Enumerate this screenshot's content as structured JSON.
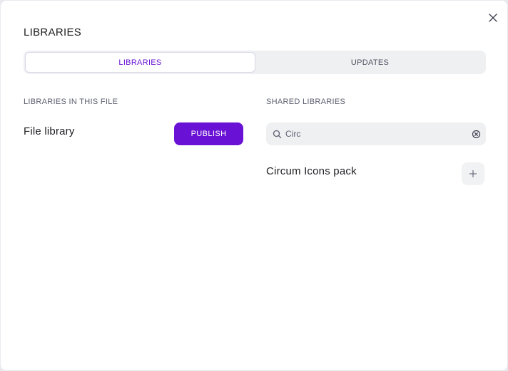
{
  "modal": {
    "title": "LIBRARIES",
    "close_icon": "close-icon"
  },
  "tabs": [
    {
      "label": "LIBRARIES",
      "active": true
    },
    {
      "label": "UPDATES",
      "active": false
    }
  ],
  "file_section": {
    "heading": "LIBRARIES IN THIS FILE",
    "library_name": "File library",
    "publish_label": "PUBLISH"
  },
  "shared_section": {
    "heading": "SHARED LIBRARIES",
    "search": {
      "value": "Circ",
      "placeholder": "Search shared libraries",
      "search_icon": "search-icon",
      "clear_icon": "clear-icon"
    },
    "results": [
      {
        "name": "Circum Icons pack",
        "add_icon": "plus-icon"
      }
    ]
  },
  "colors": {
    "accent": "#6911d4",
    "background": "#ffffff",
    "tab_bg": "#eff0f2",
    "text": "#1e1e22",
    "muted_text": "#5b5e6e"
  }
}
